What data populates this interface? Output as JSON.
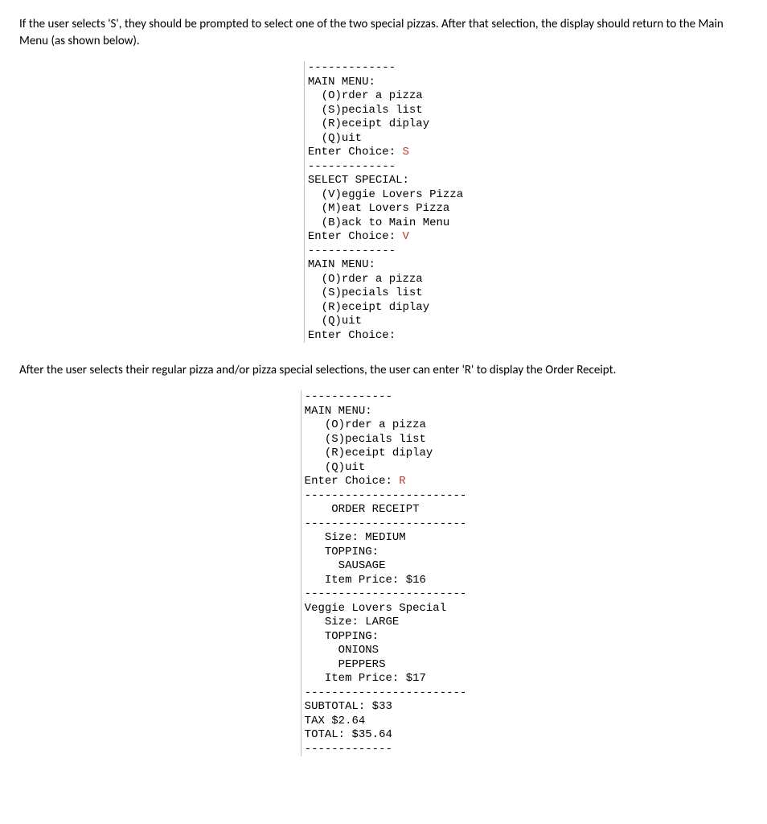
{
  "para1": "If the user selects 'S', they should be prompted to select one of the two special pizzas.  After that selection, the display should return to the Main Menu (as shown below).",
  "para2": "After the user selects their regular pizza and/or pizza special selections, the user can enter 'R' to display the Order Receipt.",
  "term1": {
    "sep13": "-------------",
    "mainMenuHeader": "MAIN MENU:",
    "optOrder": "  (O)rder a pizza",
    "optSpecials": "  (S)pecials list",
    "optReceipt": "  (R)eceipt diplay",
    "optQuit": "  (Q)uit",
    "enterChoicePrefix": "Enter Choice: ",
    "choiceS": "S",
    "selectSpecialHeader": "SELECT SPECIAL:",
    "optVeggie": "  (V)eggie Lovers Pizza",
    "optMeat": "  (M)eat Lovers Pizza",
    "optBack": "  (B)ack to Main Menu",
    "choiceV": "V",
    "enterChoiceBlank": "Enter Choice:"
  },
  "term2": {
    "sep13": "-------------",
    "sep24": "------------------------",
    "mainMenuHeader": "MAIN MENU:",
    "optOrder": "   (O)rder a pizza",
    "optSpecials": "   (S)pecials list",
    "optReceipt": "   (R)eceipt diplay",
    "optQuit": "   (Q)uit",
    "enterChoicePrefix": "Enter Choice: ",
    "choiceR": "R",
    "receiptTitle": "    ORDER RECEIPT",
    "item1_size": "   Size: MEDIUM",
    "item1_toppingLabel": "   TOPPING:",
    "item1_top1": "     SAUSAGE",
    "item1_price": "   Item Price: $16",
    "item2_name": "Veggie Lovers Special",
    "item2_size": "   Size: LARGE",
    "item2_toppingLabel": "   TOPPING:",
    "item2_top1": "     ONIONS",
    "item2_top2": "     PEPPERS",
    "item2_price": "   Item Price: $17",
    "subtotal": "SUBTOTAL: $33",
    "tax": "TAX $2.64",
    "total": "TOTAL: $35.64"
  }
}
